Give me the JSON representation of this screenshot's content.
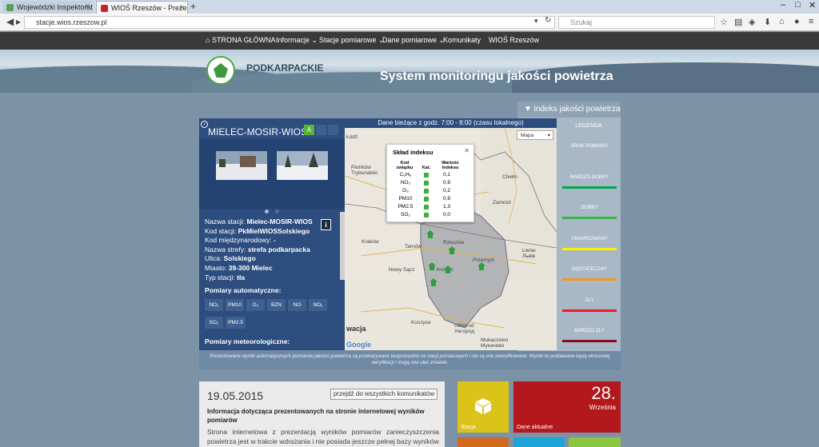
{
  "browser": {
    "tabs": [
      {
        "label": "Wojewódzki Inspektorat O...",
        "active": false
      },
      {
        "label": "WIOŚ Rzeszów - Prezentacj...",
        "active": true
      }
    ],
    "url": "stacje.wios.rzeszow.pl",
    "search_placeholder": "Szukaj",
    "window_controls": [
      "–",
      "□",
      "✕"
    ]
  },
  "site_menu": {
    "home": "STRONA GŁÓWNA",
    "items": [
      "Informacje ⌄",
      "Stacje pomiarowe ⌄",
      "Dane pomiarowe ⌄",
      "Komunikaty",
      "WIOŚ Rzeszów"
    ]
  },
  "header": {
    "region": "PODKARPACKIE",
    "system_title": "System monitoringu jakości powietrza"
  },
  "legend": {
    "toggle_label": "▼  indeks jakości powietrza",
    "title": "LEGENDA",
    "items": [
      {
        "label": "BRAK POMIARU",
        "color": "#a9b8c6"
      },
      {
        "label": "BARDZO DOBRY",
        "color": "#00a651"
      },
      {
        "label": "DOBRY",
        "color": "#39b54a"
      },
      {
        "label": "UMIARKOWANY",
        "color": "#fff200"
      },
      {
        "label": "DOSTATECZNY",
        "color": "#f7941d"
      },
      {
        "label": "ZŁY",
        "color": "#ed1c24"
      },
      {
        "label": "BARDZO ZŁY",
        "color": "#8b0b1e"
      }
    ]
  },
  "station": {
    "name_title": "MIELEC-MOSIR-WIOS",
    "aqi_badge": "A",
    "current_data": "Dane bieżące z godz. 7:00 - 8:00 (czasu lokalnego)",
    "fields": [
      {
        "label": "Nazwa stacji: ",
        "value": "Mielec-MOSIR-WIOS"
      },
      {
        "label": "Kod stacji: ",
        "value": "PkMielWIOSSolskiego"
      },
      {
        "label": "Kod międzynarodowy: ",
        "value": "-"
      },
      {
        "label": "Nazwa strefy: ",
        "value": "strefa podkarpacka"
      },
      {
        "label": "Ulica: ",
        "value": "Solskiego"
      },
      {
        "label": "Miasto: ",
        "value": "39-300 Mielec"
      },
      {
        "label": "Typ stacji: ",
        "value": "tła"
      }
    ],
    "auto_label": "Pomiary automatyczne:",
    "auto_chips": [
      "NO₂",
      "PM10",
      "O₃",
      "BZN",
      "NO",
      "NOₓ",
      "SO₂",
      "PM2.5"
    ],
    "meteo_label": "Pomiary meteorologiczne:"
  },
  "map": {
    "type_select": "Mapa",
    "labels": {
      "lodz": "Łódź",
      "piotrkow": "Piotrków\nTrybunalski",
      "krakow": "Kraków",
      "tarnow": "Tarnów",
      "rzeszow": "Rzeszów",
      "przemysl": "Przemyśl",
      "lwow": "Lwów\nЛьвів",
      "zamosc": "Zamość",
      "chelm": "Chełm",
      "nowy_sacz": "Nowy Sącz",
      "krosno": "Krosno",
      "kosice": "Koszyce",
      "uzhorod": "Użhorod\nУжгород",
      "mukachevo": "Mukaczewo\nМукачево",
      "slovakia": "wacja",
      "google": "Google"
    },
    "popup": {
      "title": "Skład indeksu",
      "headers": {
        "code": "Kod\nzwiązku",
        "cat": "Kat.",
        "value": "Wartość\nindeksu"
      },
      "rows": [
        {
          "code": "C₆H₆",
          "value": "0,1"
        },
        {
          "code": "NO₂",
          "value": "0,9"
        },
        {
          "code": "O₃",
          "value": "0,2"
        },
        {
          "code": "PM10",
          "value": "0,9"
        },
        {
          "code": "PM2.5",
          "value": "1,3"
        },
        {
          "code": "SO₂",
          "value": "0,0"
        }
      ]
    }
  },
  "disclaimer": "Prezentowane wyniki automatycznych pomiarów jakości powietrza są przekazywane bezpośrednio ze stacji pomiarowych i nie są one zweryfikowane. Wyniki te poddawane będą okresowej weryfikacji i mogą one ulec zmianie.",
  "news": {
    "date": "19.05.2015",
    "all_button": "przejdź do wszystkich komunikatów",
    "title": "Informacja dotycząca prezentowanych na stronie internetowej wyników pomiarów",
    "body": "Strona internetowa z prezentacją wyników pomiarów zanieczyszczenia powietrza jest w trakcie wdrażania i nie posiada jeszcze pełnej bazy wyników"
  },
  "tiles": {
    "stacje": "Stacje",
    "dane": "Dane aktualne",
    "day": "28.",
    "month": "Września"
  }
}
